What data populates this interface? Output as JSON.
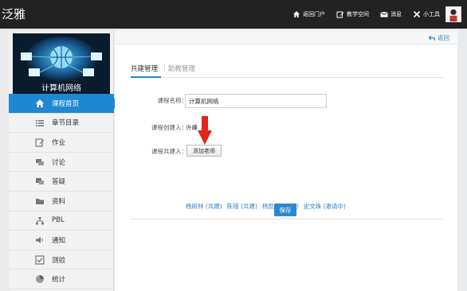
{
  "app": {
    "brand": "泛雅"
  },
  "topnav": {
    "items": [
      {
        "label": "返回门户",
        "icon": "home-icon"
      },
      {
        "label": "教学空间",
        "icon": "edit-icon"
      },
      {
        "label": "消息",
        "icon": "mail-icon"
      },
      {
        "label": "小工具",
        "icon": "tools-icon"
      }
    ]
  },
  "banner": {
    "title": "计算机网络"
  },
  "sidebar": {
    "items": [
      {
        "label": "课程首页",
        "icon": "home-icon",
        "active": true
      },
      {
        "label": "章节目录",
        "icon": "list-icon"
      },
      {
        "label": "作业",
        "icon": "edit-icon"
      },
      {
        "label": "讨论",
        "icon": "chat-icon"
      },
      {
        "label": "答疑",
        "icon": "qa-icon"
      },
      {
        "label": "资料",
        "icon": "folder-icon"
      },
      {
        "label": "PBL",
        "icon": "sitemap-icon"
      },
      {
        "label": "通知",
        "icon": "speaker-icon"
      },
      {
        "label": "测验",
        "icon": "checkbox-icon"
      },
      {
        "label": "统计",
        "icon": "pie-icon"
      }
    ]
  },
  "main": {
    "back_label": "返回",
    "tabs": [
      {
        "label": "共建管理",
        "active": true
      },
      {
        "label": "助教管理",
        "active": false
      }
    ],
    "form": {
      "course_name_label": "课程名称：",
      "course_name_value": "计算机网络",
      "creator_label": "课程创建人：",
      "creator_value": "许峰",
      "coworker_label": "课程共建人：",
      "add_teacher_label": "添加老师"
    },
    "collaborators": [
      "杨树林 (共建)",
      "陈错 (共建)",
      "杨凯彬 (共建)",
      "史文珠 (邀请中)"
    ],
    "save_label": "保存"
  },
  "colors": {
    "accent": "#1e88d4",
    "topbar": "#222222",
    "link": "#2a86c8"
  }
}
